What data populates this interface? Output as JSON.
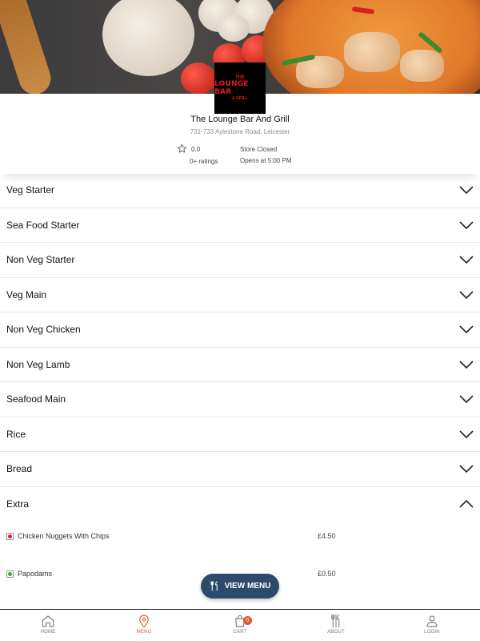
{
  "restaurant": {
    "logo_line1": "THE",
    "logo_line2": "LOUNGE BAR",
    "logo_line3": "& GRILL",
    "name": "The Lounge Bar And Grill",
    "address": "731-733 Aylestone Road, Leicester",
    "rating": "0.0",
    "ratings_count": "0+ ratings",
    "status": "Store Closed",
    "opens": "Opens at 5:00 PM"
  },
  "categories": [
    {
      "name": "Veg Starter",
      "expanded": false
    },
    {
      "name": "Sea Food Starter",
      "expanded": false
    },
    {
      "name": "Non Veg Starter",
      "expanded": false
    },
    {
      "name": "Veg Main",
      "expanded": false
    },
    {
      "name": "Non Veg Chicken",
      "expanded": false
    },
    {
      "name": "Non Veg Lamb",
      "expanded": false
    },
    {
      "name": "Seafood Main",
      "expanded": false
    },
    {
      "name": "Rice",
      "expanded": false
    },
    {
      "name": "Bread",
      "expanded": false
    },
    {
      "name": "Extra",
      "expanded": true
    }
  ],
  "extra_items": [
    {
      "name": "Chicken Nuggets With Chips",
      "price": "£4.50",
      "diet": "non-veg"
    },
    {
      "name": "Papodams",
      "price": "£0.50",
      "diet": "veg"
    }
  ],
  "view_menu_label": "VIEW MENU",
  "bottom_nav": [
    {
      "label": "HOME",
      "icon": "home-icon",
      "active": false
    },
    {
      "label": "MENU",
      "icon": "location-pin-icon",
      "active": true
    },
    {
      "label": "CART",
      "icon": "cart-bag-icon",
      "active": false,
      "badge": "0"
    },
    {
      "label": "ABOUT",
      "icon": "cutlery-icon",
      "active": false
    },
    {
      "label": "LOGIN",
      "icon": "user-icon",
      "active": false
    }
  ],
  "colors": {
    "accent": "#e0582a",
    "view_menu_bg": "#2e4a6a",
    "veg": "#3aa83a",
    "non_veg": "#d42424"
  }
}
